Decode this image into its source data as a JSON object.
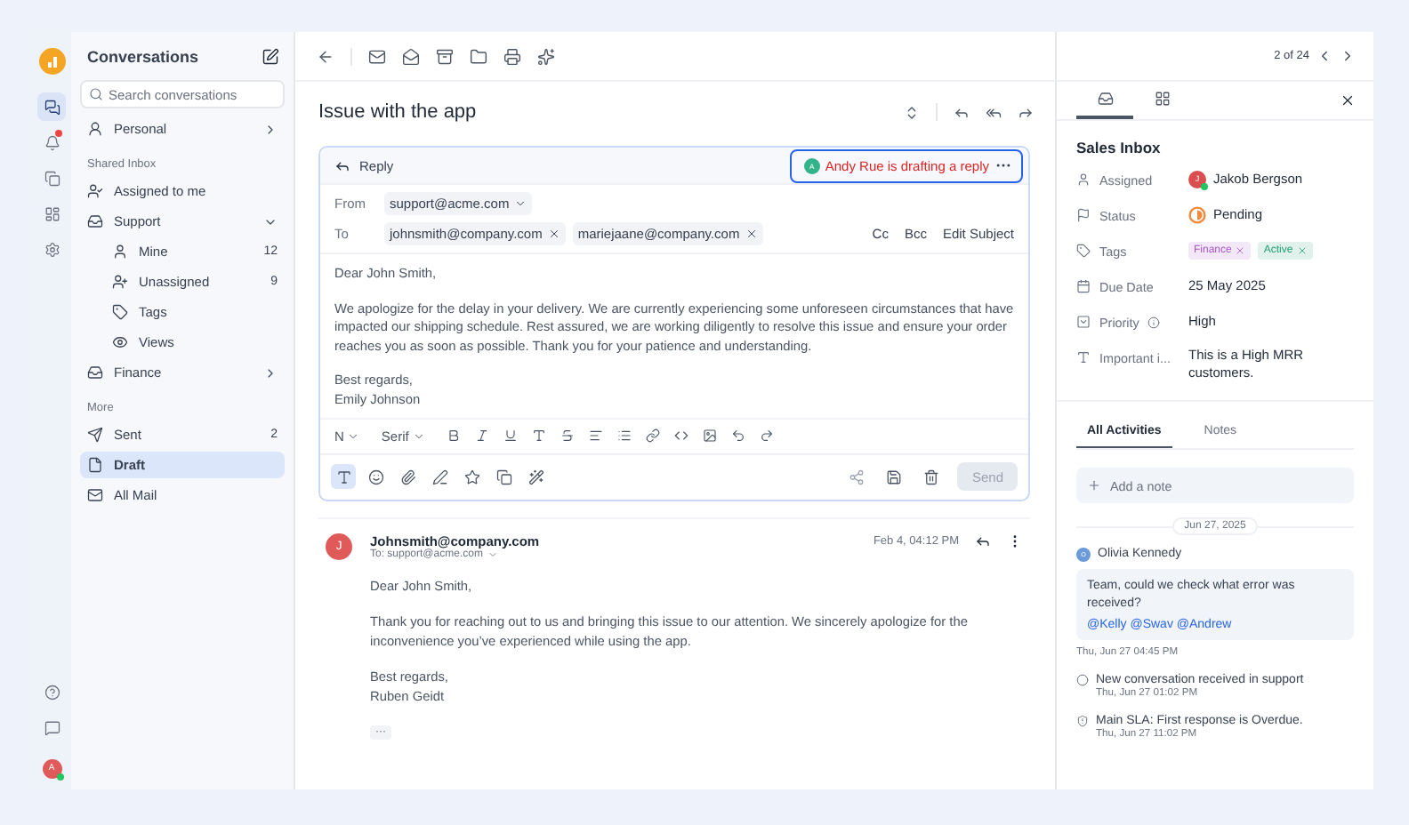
{
  "rail": {
    "avatar": "A",
    "items": [
      {
        "kind": "chat",
        "selected": true
      },
      {
        "kind": "bell",
        "selected": false,
        "badge": true
      },
      {
        "kind": "copy",
        "selected": false
      },
      {
        "kind": "report",
        "selected": false
      },
      {
        "kind": "settings",
        "selected": false
      }
    ],
    "bottom": [
      {
        "kind": "help",
        "selected": false
      },
      {
        "kind": "message",
        "selected": false
      }
    ]
  },
  "sidebar": {
    "title": "Conversations",
    "search": {
      "placeholder": "Search conversations"
    },
    "items": [
      {
        "kind": "personal",
        "label": "Personal",
        "expanded": false,
        "selected": false
      }
    ],
    "sections": [
      {
        "heading": "Shared Inbox",
        "items": [
          {
            "kind": "assigned",
            "label": "Assigned to me",
            "selected": false
          },
          {
            "kind": "inbox",
            "label": "Support",
            "expanded": true,
            "selected": false,
            "children": [
              {
                "kind": "user",
                "label": "Mine",
                "count": "12",
                "selected": false
              },
              {
                "kind": "user-plus",
                "label": "Unassigned",
                "count": "9",
                "selected": false
              },
              {
                "kind": "tag",
                "label": "Tags",
                "selected": false
              },
              {
                "kind": "views",
                "label": "Views",
                "selected": false
              }
            ]
          },
          {
            "kind": "inbox",
            "label": "Finance",
            "expanded": false,
            "selected": false
          }
        ]
      },
      {
        "heading": "More",
        "items": [
          {
            "kind": "send",
            "label": "Sent",
            "count": "2",
            "selected": false
          },
          {
            "kind": "file",
            "label": "Draft",
            "selected": true
          },
          {
            "kind": "mail",
            "label": "All Mail",
            "selected": false
          }
        ]
      }
    ]
  },
  "thread": {
    "title": "Issue with the app",
    "pagination": "2 of 24",
    "composer": {
      "mode": "Reply",
      "presence": {
        "avatar": "A",
        "text": "Andy Rue is drafting a reply"
      },
      "from": {
        "label": "From",
        "value": "support@acme.com"
      },
      "to": {
        "label": "To",
        "recipients": [
          "johnsmith@company.com",
          "mariejaane@company.com"
        ]
      },
      "links": [
        "Cc",
        "Bcc",
        "Edit Subject"
      ],
      "body": [
        "Dear John Smith,",
        "We apologize for the delay in your delivery. We are currently experiencing some unforeseen circumstances that have impacted our shipping schedule. Rest assured, we are working diligently to resolve this issue and ensure your order reaches you as soon as possible. Thank you for your patience and understanding.",
        "Best regards,\nEmily Johnson"
      ],
      "heading_select": "N",
      "font_select": "Serif",
      "tools": [
        {
          "kind": "text",
          "selected": true
        },
        {
          "kind": "emoji",
          "selected": false
        },
        {
          "kind": "attach",
          "selected": false
        },
        {
          "kind": "signature",
          "selected": false
        },
        {
          "kind": "star",
          "selected": false
        },
        {
          "kind": "copy",
          "selected": false
        },
        {
          "kind": "magic",
          "selected": false
        }
      ],
      "send": {
        "label": "Send",
        "disabled": true
      }
    },
    "messages": [
      {
        "avatar": "J",
        "sender": "Johnsmith@company.com",
        "to": "To: support@acme.com",
        "time": "Feb 4, 04:12 PM",
        "body": [
          "Dear John Smith,",
          "Thank you for reaching out to us and bringing this issue to our attention. We sincerely apologize for the inconvenience you’ve experienced while using the app.",
          "Best regards,\nRuben Geidt"
        ],
        "more": "···"
      }
    ]
  },
  "details": {
    "tabs": [
      {
        "kind": "inbox",
        "selected": true
      },
      {
        "kind": "grid",
        "selected": false
      }
    ],
    "title": "Sales Inbox",
    "fields": [
      {
        "kind": "person",
        "label": "Assigned",
        "value": "Jakob Bergson",
        "avatar": "J"
      },
      {
        "kind": "status",
        "label": "Status",
        "value": "Pending"
      },
      {
        "kind": "tags",
        "label": "Tags",
        "tags": [
          {
            "label": "Finance",
            "color": "#a855c7"
          },
          {
            "label": "Active",
            "color": "#1f9d72"
          }
        ]
      },
      {
        "kind": "date",
        "label": "Due Date",
        "value": "25 May 2025"
      },
      {
        "kind": "priority",
        "label": "Priority",
        "value": "High"
      },
      {
        "kind": "text",
        "label": "Important i...",
        "value": "This is a High MRR customers."
      }
    ],
    "activity_tabs": [
      {
        "label": "All Activities",
        "selected": true
      },
      {
        "label": "Notes",
        "selected": false
      }
    ],
    "add_note": "Add a note",
    "date": "Jun 27, 2025",
    "note": {
      "avatar": "O",
      "author": "Olivia Kennedy",
      "text": "Team, could we check what error was received?",
      "mentions": "@Kelly @Swav @Andrew",
      "time": "Thu, Jun 27 04:45 PM"
    },
    "events": [
      {
        "kind": "conversation",
        "text": "New conversation received in support",
        "time": "Thu, Jun 27 01:02 PM"
      },
      {
        "kind": "sla",
        "text": "Main SLA: First response is Overdue.",
        "time": "Thu, Jun 27 11:02 PM"
      }
    ]
  }
}
